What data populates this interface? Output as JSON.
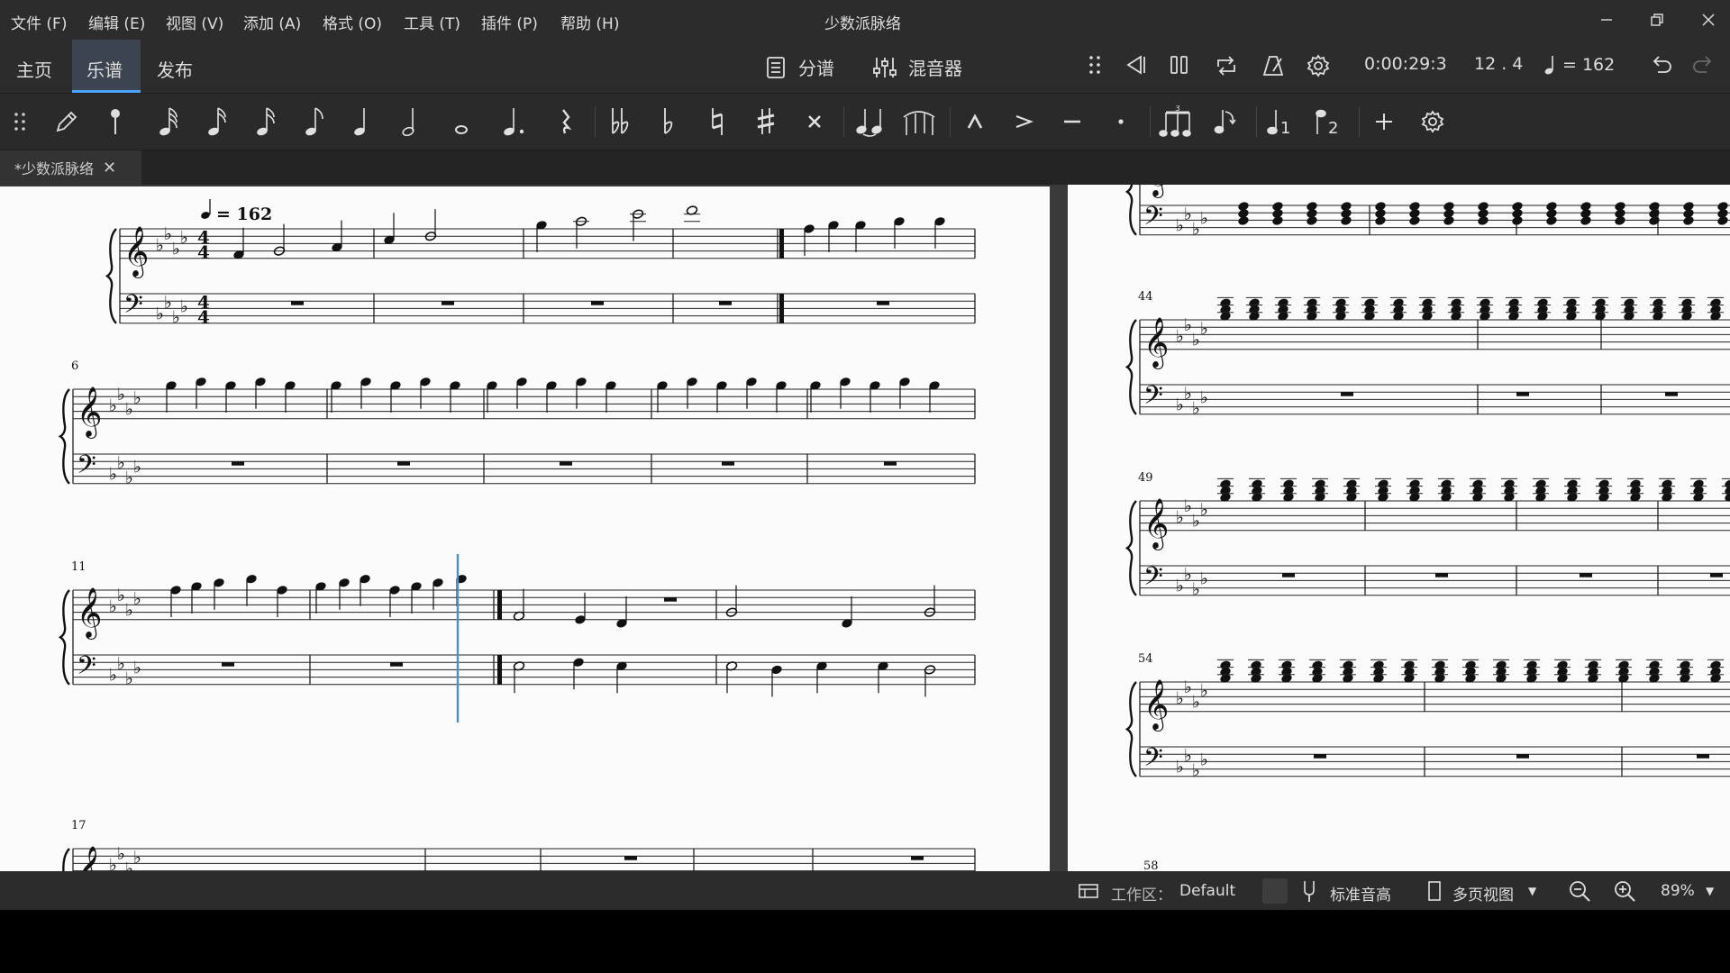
{
  "app": {
    "title": "少数派脉络"
  },
  "menu": [
    "文件 (F)",
    "编辑 (E)",
    "视图 (V)",
    "添加 (A)",
    "格式 (O)",
    "工具 (T)",
    "插件 (P)",
    "帮助 (H)"
  ],
  "nav_tabs": {
    "home": "主页",
    "score": "乐谱",
    "publish": "发布"
  },
  "toolbar": {
    "parts_label": "分谱",
    "mixer_label": "混音器",
    "time": "0:00:29:3",
    "position": "12 . 4",
    "tempo": "= 162"
  },
  "document_tab": {
    "label": "*少数派脉络"
  },
  "score": {
    "tempo_marking": "= 162",
    "measure_numbers": [
      "6",
      "11",
      "17",
      "44",
      "49",
      "54",
      "58"
    ]
  },
  "status": {
    "workspace_label": "工作区：",
    "workspace_value": "Default",
    "concert_pitch": "标准音高",
    "view_mode": "多页视图",
    "zoom": "89%"
  },
  "colors": {
    "accent": "#4aa3ff",
    "chrome": "#2c2c2c",
    "page": "#fbfbfb",
    "cursor": "#4a90c8"
  }
}
